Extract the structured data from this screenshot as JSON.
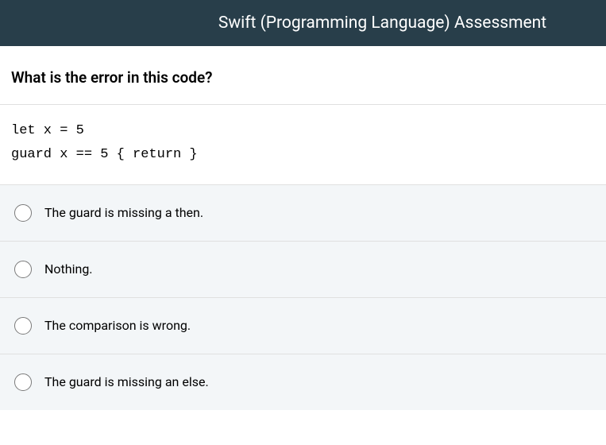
{
  "header": {
    "title": "Swift (Programming Language) Assessment"
  },
  "question": {
    "text": "What is the error in this code?"
  },
  "code": {
    "line1": "let x = 5",
    "line2": "guard x == 5 { return }"
  },
  "answers": [
    {
      "label": "The guard is missing a then."
    },
    {
      "label": "Nothing."
    },
    {
      "label": "The comparison is wrong."
    },
    {
      "label": "The guard is missing an else."
    }
  ]
}
